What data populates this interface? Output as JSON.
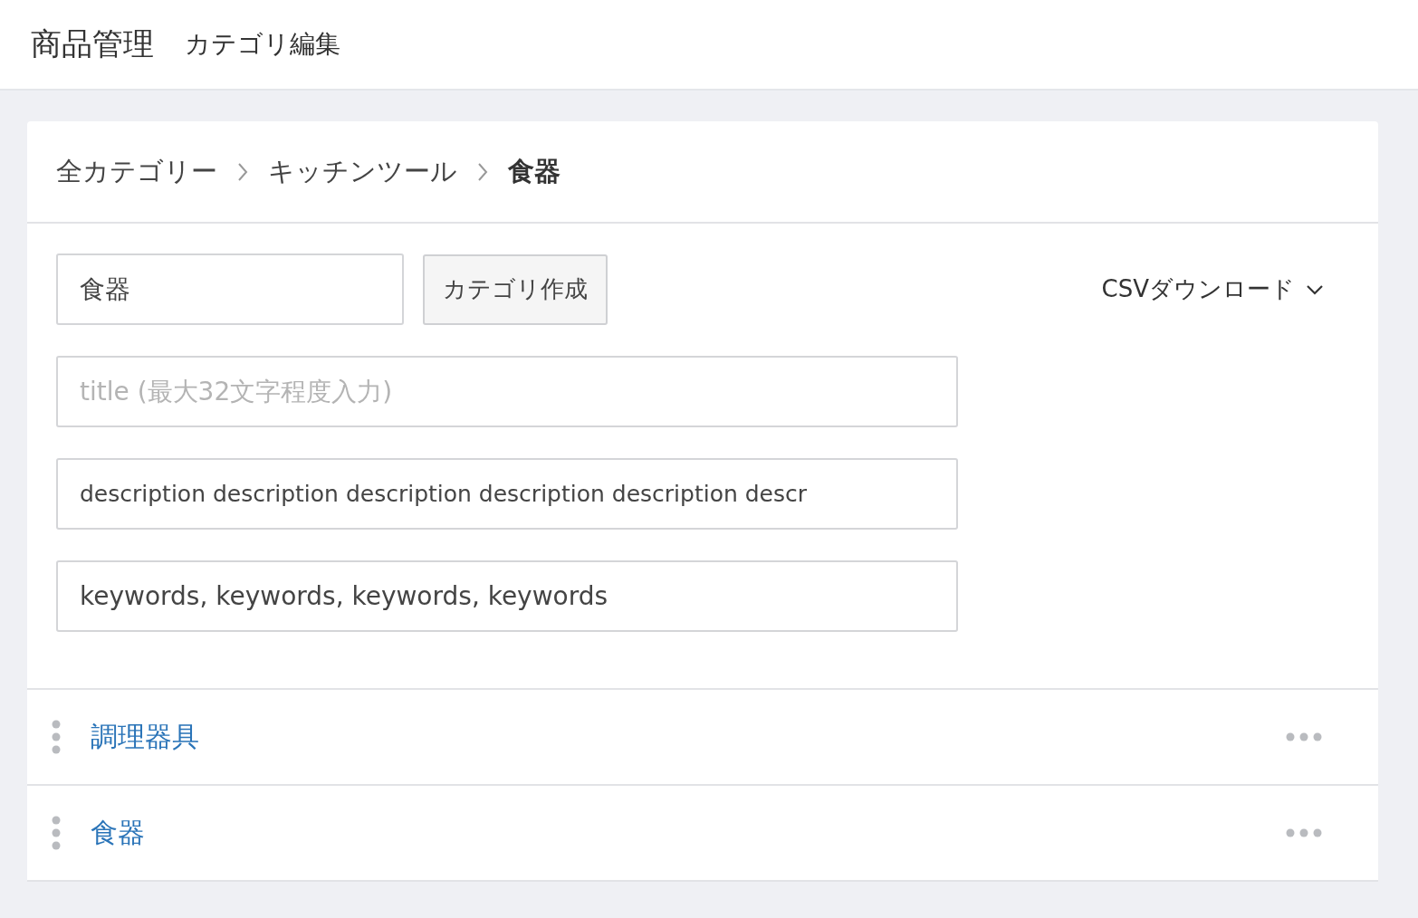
{
  "header": {
    "title": "商品管理",
    "subtitle": "カテゴリ編集"
  },
  "breadcrumb": [
    {
      "label": "全カテゴリー",
      "current": false
    },
    {
      "label": "キッチンツール",
      "current": false
    },
    {
      "label": "食器",
      "current": true
    }
  ],
  "form": {
    "name_field": {
      "value": "食器"
    },
    "create_button": "カテゴリ作成",
    "csv_download": "CSVダウンロード",
    "title_field": {
      "placeholder": "title (最大32文字程度入力)"
    },
    "description_field": {
      "value": "description description description description description descr"
    },
    "keywords_field": {
      "value": "keywords, keywords, keywords, keywords"
    }
  },
  "categories": [
    {
      "label": "調理器具"
    },
    {
      "label": "食器"
    }
  ]
}
